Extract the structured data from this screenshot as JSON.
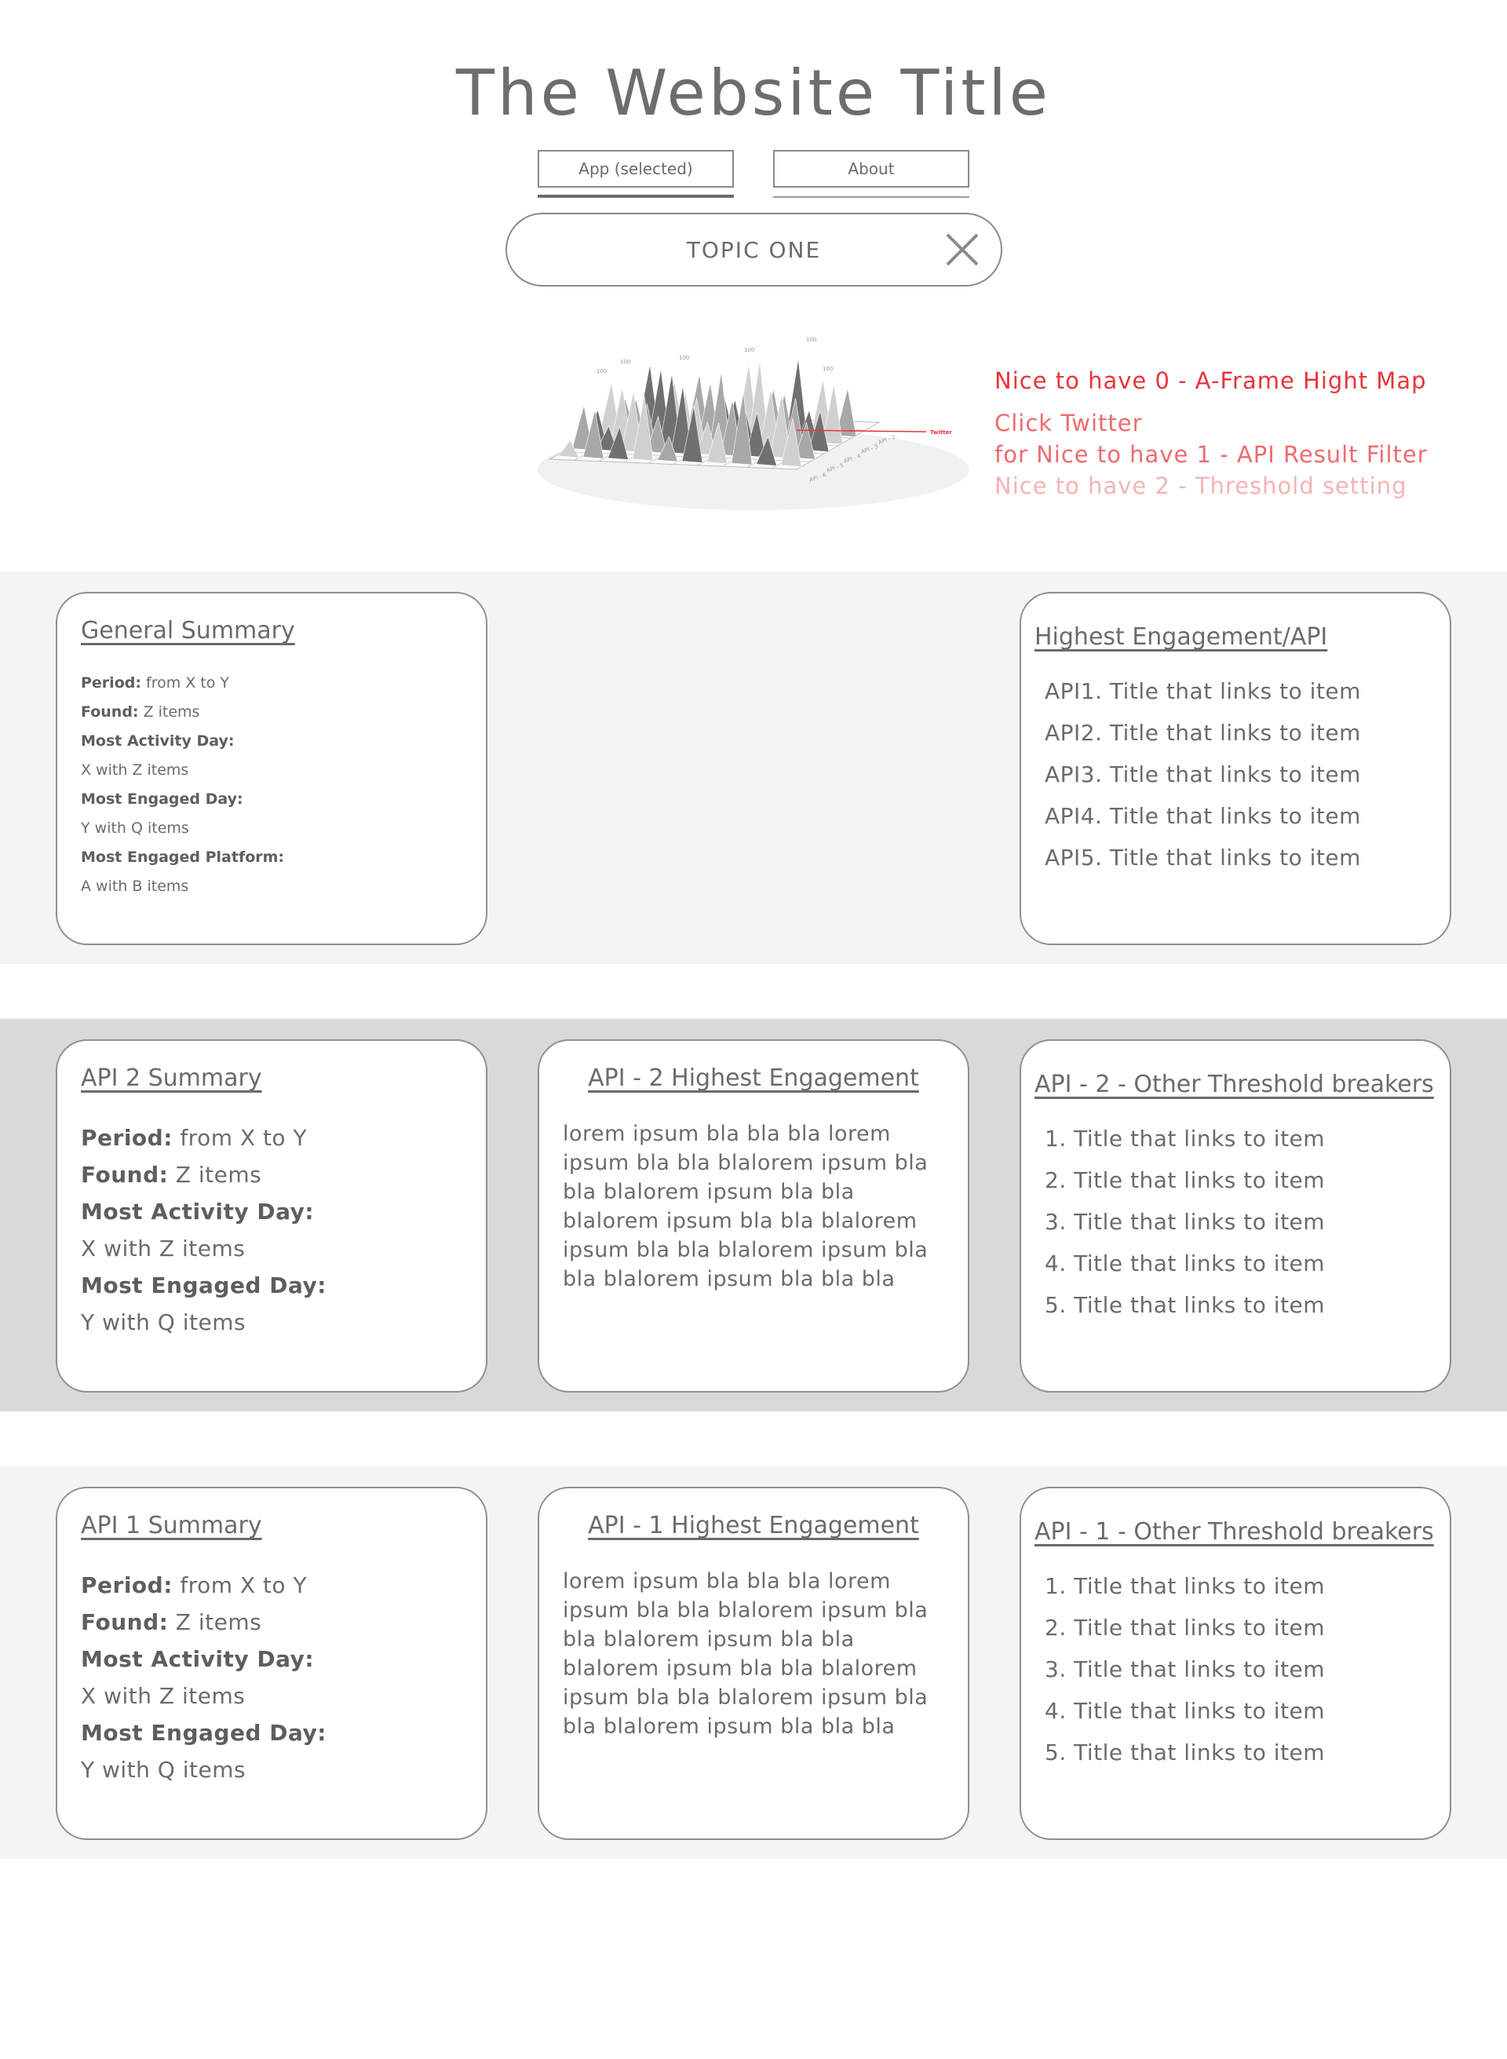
{
  "header": {
    "title": "The Website Title",
    "tabs": [
      {
        "label": "App (selected)",
        "selected": true
      },
      {
        "label": "About",
        "selected": false
      }
    ],
    "topic": "TOPIC ONE"
  },
  "heightmap": {
    "peak_labels": [
      "100",
      "100",
      "100",
      "100",
      "100",
      "100"
    ],
    "row_labels": [
      "API - 2",
      "API - 3",
      "API - 4",
      "API - 5",
      "API - 6"
    ],
    "highlight_label": "Twitter",
    "colors": {
      "highlight": "#e8343a",
      "dark": "#707070",
      "mid": "#a8a8a8",
      "light": "#d0d0d0"
    }
  },
  "notes": {
    "nice0": "Nice to have 0 - A-Frame Hight Map",
    "nice1a": "Click Twitter",
    "nice1b": "for Nice to have 1 - API Result Filter",
    "nice2": "Nice to have 2 - Threshold setting"
  },
  "general_summary": {
    "title": "General Summary",
    "period_label": "Period:",
    "period_value": "from X to Y",
    "found_label": "Found:",
    "found_value": "Z items",
    "activity_label": "Most Activity Day:",
    "activity_value": "X with Z items",
    "engaged_label": "Most Engaged Day:",
    "engaged_value": "Y with Q items",
    "platform_label": "Most Engaged Platform:",
    "platform_value": "A with B items"
  },
  "highest_engagement_api": {
    "title": "Highest Engagement/API",
    "items": [
      "API1. Title that links to item",
      "API2. Title that links to item",
      "API3. Title that links to item",
      "API4. Title that links to item",
      "API5. Title that links to item"
    ]
  },
  "api2": {
    "summary_title": "API 2 Summary",
    "period_label": "Period:",
    "period_value": "from X to Y",
    "found_label": "Found:",
    "found_value": "Z items",
    "activity_label": "Most Activity Day:",
    "activity_value": "X with Z items",
    "engaged_label": "Most Engaged Day:",
    "engaged_value": "Y with Q items",
    "highest_title": "API - 2 Highest Engagement",
    "highest_lines": [
      "lorem ipsum bla bla bla lorem",
      "ipsum bla bla blalorem ipsum bla",
      "bla blalorem ipsum bla bla",
      "blalorem ipsum bla bla blalorem",
      "ipsum bla bla blalorem ipsum bla",
      "bla blalorem ipsum bla bla bla"
    ],
    "threshold_title": "API - 2 - Other Threshold  breakers",
    "threshold_items": [
      "1. Title that links to item",
      "2. Title that links to item",
      "3. Title that links to item",
      "4. Title that links to item",
      "5. Title that links to item"
    ]
  },
  "api1": {
    "summary_title": "API 1 Summary",
    "period_label": "Period:",
    "period_value": "from X to Y",
    "found_label": "Found:",
    "found_value": "Z items",
    "activity_label": "Most Activity Day:",
    "activity_value": "X with Z items",
    "engaged_label": "Most Engaged Day:",
    "engaged_value": "Y with Q items",
    "highest_title": "API - 1 Highest Engagement ",
    "highest_lines": [
      "lorem ipsum bla bla bla lorem",
      "ipsum bla bla blalorem ipsum bla",
      "bla blalorem ipsum bla bla",
      "blalorem ipsum bla bla blalorem",
      "ipsum bla bla blalorem ipsum bla",
      "bla blalorem ipsum bla bla bla"
    ],
    "threshold_title": "API - 1 - Other Threshold  breakers",
    "threshold_items": [
      "1. Title that links to item",
      "2. Title that links to item",
      "3. Title that links to item",
      "4. Title that links to item",
      "5. Title that links to item"
    ]
  }
}
